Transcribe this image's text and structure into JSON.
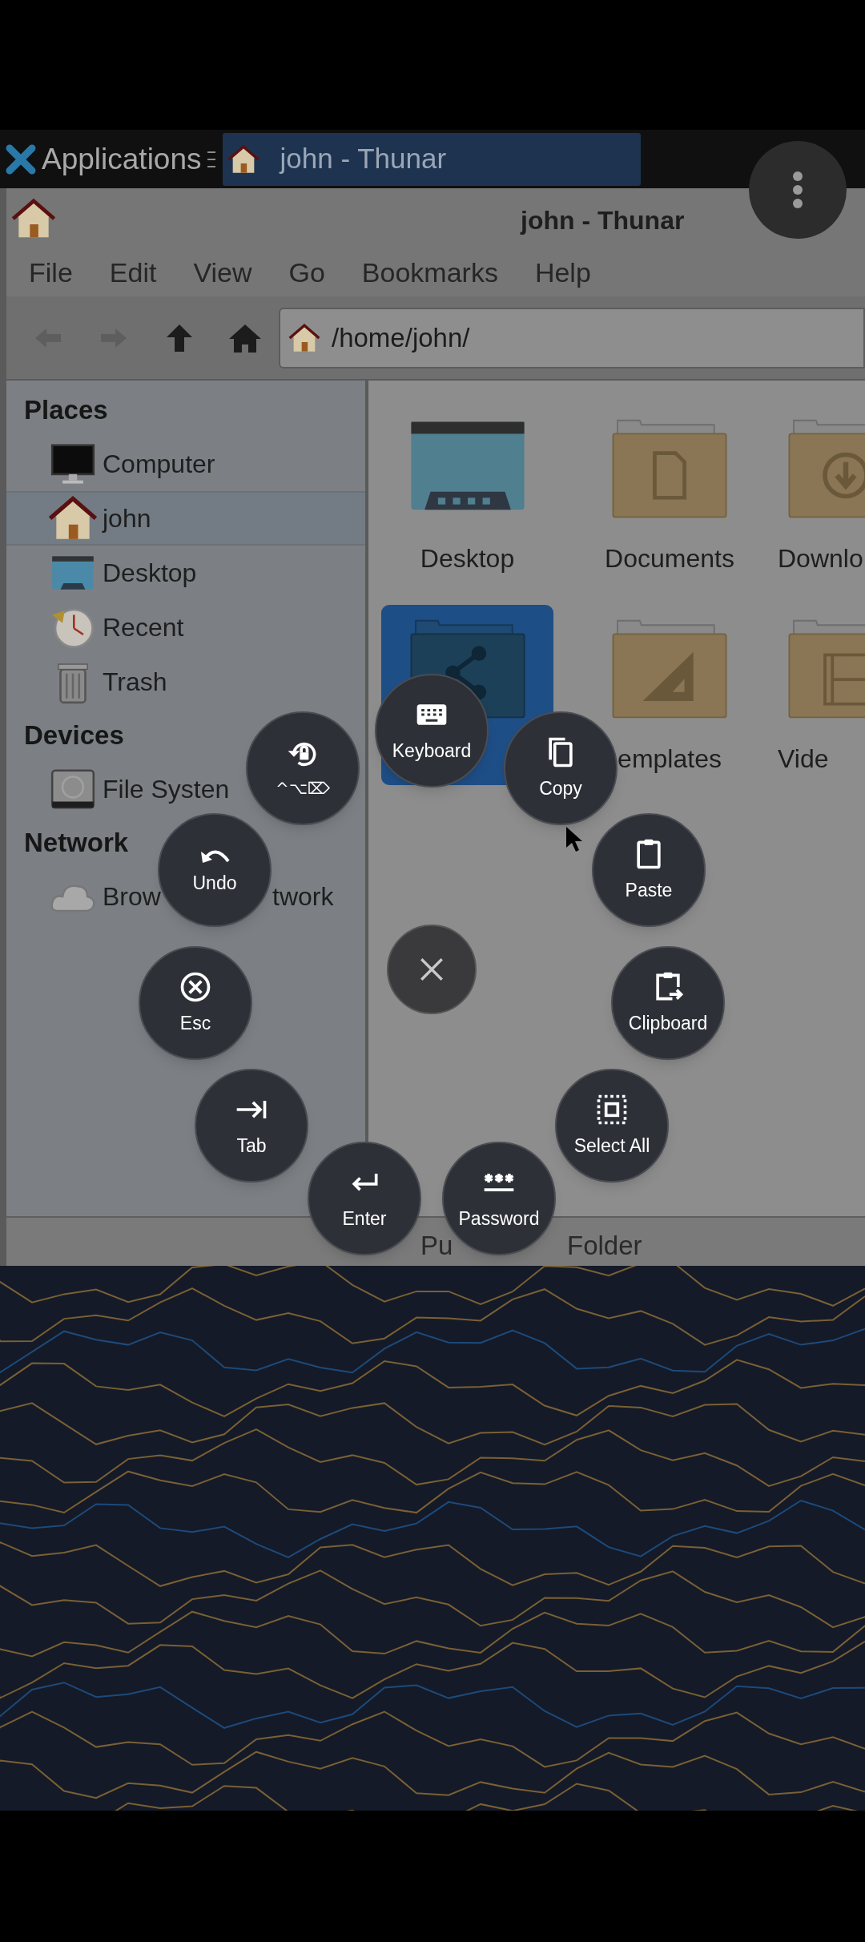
{
  "taskbar": {
    "menu_label": "Applications",
    "tasks": [
      {
        "title": "john - Thunar",
        "selected": true
      }
    ]
  },
  "window": {
    "title": "john - Thunar",
    "menu": [
      "File",
      "Edit",
      "View",
      "Go",
      "Bookmarks",
      "Help"
    ],
    "location": "/home/john/"
  },
  "sidebar": {
    "sections": [
      {
        "title": "Places",
        "items": [
          {
            "label": "Computer",
            "kind": "computer",
            "selected": false
          },
          {
            "label": "john",
            "kind": "home",
            "selected": true
          },
          {
            "label": "Desktop",
            "kind": "desktop",
            "selected": false
          },
          {
            "label": "Recent",
            "kind": "recent",
            "selected": false
          },
          {
            "label": "Trash",
            "kind": "trash",
            "selected": false
          }
        ]
      },
      {
        "title": "Devices",
        "items": [
          {
            "label": "File Systen",
            "kind": "drive",
            "selected": false
          }
        ]
      },
      {
        "title": "Network",
        "items": [
          {
            "label": "Brow",
            "label_end": "twork",
            "kind": "network",
            "selected": false
          }
        ]
      }
    ]
  },
  "files": [
    {
      "label": "Desktop",
      "kind": "desktop",
      "selected": false
    },
    {
      "label": "Documents",
      "kind": "documents",
      "selected": false
    },
    {
      "label": "Downlo",
      "kind": "downloads",
      "selected": false
    },
    {
      "kind": "public",
      "selected": true
    },
    {
      "label": "emplates",
      "kind": "templates",
      "selected": false
    },
    {
      "label": "Vide",
      "kind": "videos",
      "selected": false
    }
  ],
  "status_bar": [
    "Pu",
    "Folder"
  ],
  "quick_menu": {
    "items": [
      {
        "label": "Keyboard",
        "kind": "keyboard"
      },
      {
        "label": "Copy",
        "kind": "copy"
      },
      {
        "label": "Paste",
        "kind": "paste"
      },
      {
        "label": "Clipboard",
        "kind": "clipboard"
      },
      {
        "label": "Select All",
        "kind": "select_all"
      },
      {
        "label": "Password",
        "kind": "password"
      },
      {
        "label": "Enter",
        "kind": "enter"
      },
      {
        "label": "Tab",
        "kind": "tab"
      },
      {
        "label": "Esc",
        "kind": "esc"
      },
      {
        "label": "Undo",
        "kind": "undo"
      },
      {
        "label": "^⌥⌦",
        "kind": "lock"
      }
    ]
  }
}
